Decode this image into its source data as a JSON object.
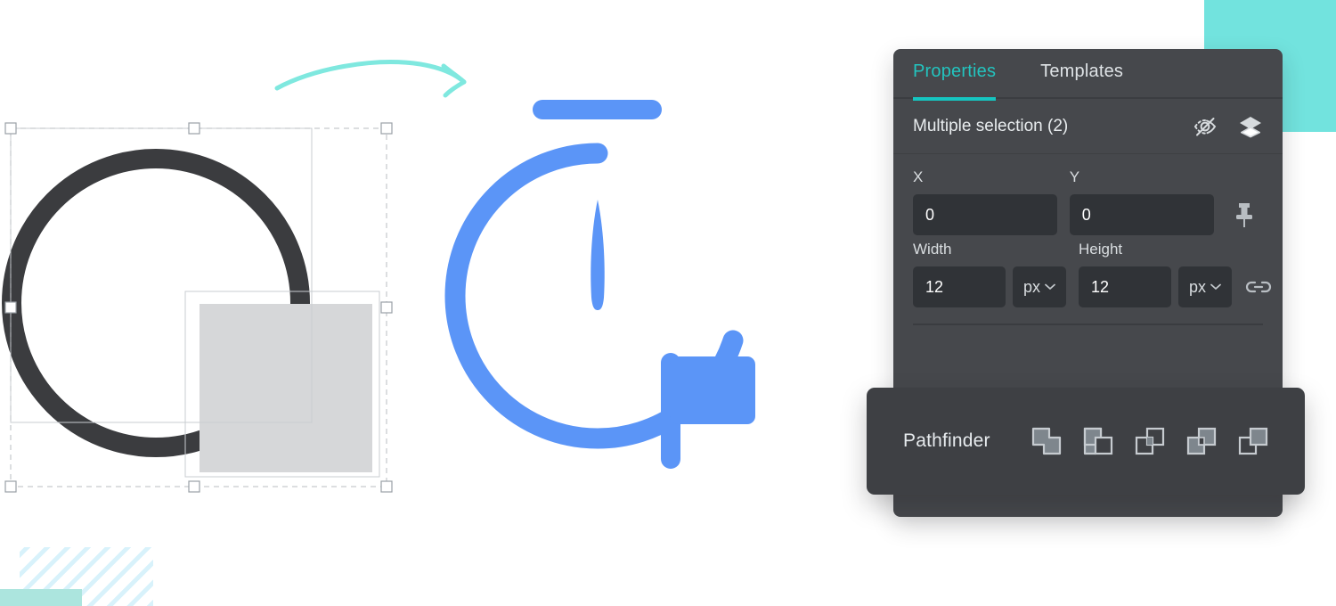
{
  "panel": {
    "tabs": [
      {
        "label": "Properties",
        "active": true
      },
      {
        "label": "Templates",
        "active": false
      }
    ],
    "selection": {
      "title": "Multiple selection (2)",
      "count": 2,
      "hide_icon": "eye-off-icon",
      "layers_icon": "layers-icon"
    },
    "fields": {
      "x": {
        "label": "X",
        "value": "0"
      },
      "y": {
        "label": "Y",
        "value": "0"
      },
      "width": {
        "label": "Width",
        "value": "12",
        "unit": "px"
      },
      "height": {
        "label": "Height",
        "value": "12",
        "unit": "px"
      }
    },
    "pin_icon": "pin-icon",
    "link_icon": "link-icon"
  },
  "pathfinder": {
    "label": "Pathfinder",
    "operations": [
      {
        "name": "union",
        "title": "Union"
      },
      {
        "name": "subtract",
        "title": "Subtract"
      },
      {
        "name": "intersect",
        "title": "Intersect"
      },
      {
        "name": "exclude",
        "title": "Exclude"
      },
      {
        "name": "divide",
        "title": "Divide"
      }
    ]
  },
  "canvas": {
    "selection_objects": [
      {
        "name": "circle-ring",
        "color": "#3b3c3f"
      },
      {
        "name": "gray-square",
        "color": "#d6d7d9"
      }
    ],
    "illustration": {
      "name": "stopwatch-illustration",
      "color": "#5b95f7",
      "parts": [
        "crown-bar",
        "dial-arc",
        "needle",
        "flag"
      ]
    },
    "arrow": {
      "name": "hand-drawn-arrow",
      "color": "#7fe8df"
    }
  },
  "colors": {
    "accent_teal": "#15c5c0",
    "panel_bg": "#46484c",
    "pathfinder_bg": "#3e4044",
    "input_bg": "#303337",
    "illustration_blue": "#5b95f7",
    "deco_teal": "#72e3de",
    "deco_mint": "#ace5de",
    "deco_stripe": "#d8f2fb",
    "shape_dark": "#3b3c3f",
    "shape_gray": "#d6d7d9"
  }
}
